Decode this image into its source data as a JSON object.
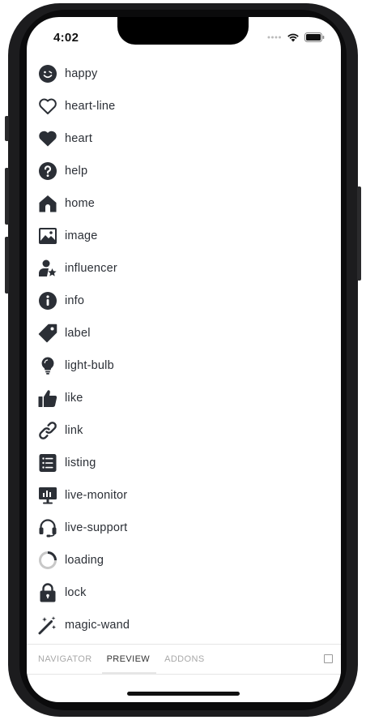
{
  "status_bar": {
    "time": "4:02"
  },
  "icons": [
    {
      "icon": "happy-icon",
      "label": "happy"
    },
    {
      "icon": "heart-line-icon",
      "label": "heart-line"
    },
    {
      "icon": "heart-icon",
      "label": "heart"
    },
    {
      "icon": "help-icon",
      "label": "help"
    },
    {
      "icon": "home-icon",
      "label": "home"
    },
    {
      "icon": "image-icon",
      "label": "image"
    },
    {
      "icon": "influencer-icon",
      "label": "influencer"
    },
    {
      "icon": "info-icon",
      "label": "info"
    },
    {
      "icon": "label-icon",
      "label": "label"
    },
    {
      "icon": "light-bulb-icon",
      "label": "light-bulb"
    },
    {
      "icon": "like-icon",
      "label": "like"
    },
    {
      "icon": "link-icon",
      "label": "link"
    },
    {
      "icon": "listing-icon",
      "label": "listing"
    },
    {
      "icon": "live-monitor-icon",
      "label": "live-monitor"
    },
    {
      "icon": "live-support-icon",
      "label": "live-support"
    },
    {
      "icon": "loading-icon",
      "label": "loading"
    },
    {
      "icon": "lock-icon",
      "label": "lock"
    },
    {
      "icon": "magic-wand-icon",
      "label": "magic-wand"
    }
  ],
  "tabs": [
    {
      "label": "NAVIGATOR",
      "active": false
    },
    {
      "label": "PREVIEW",
      "active": true
    },
    {
      "label": "ADDONS",
      "active": false
    }
  ],
  "colors": {
    "icon": "#2b2f36",
    "text": "#2b2f36",
    "tab_inactive": "#a8a8a8",
    "tab_active": "#333333"
  }
}
